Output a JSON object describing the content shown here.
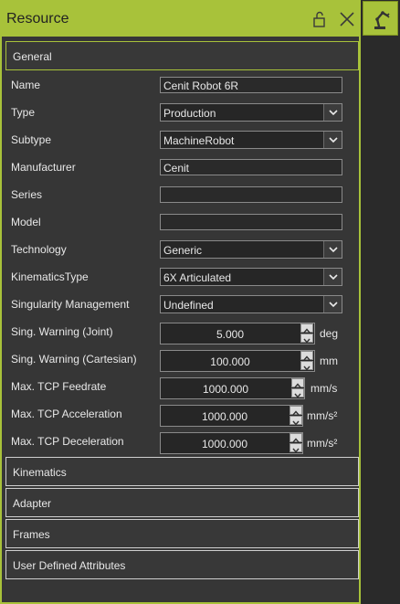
{
  "window": {
    "title": "Resource"
  },
  "icons": {
    "lock": "unlock-icon",
    "close": "close-icon",
    "side": "robot-arm-icon"
  },
  "colors": {
    "accent": "#a8c23a",
    "panel_bg": "#363636"
  },
  "sections": {
    "general": "General",
    "kinematics": "Kinematics",
    "adapter": "Adapter",
    "frames": "Frames",
    "user_defined": "User Defined Attributes"
  },
  "fields": {
    "name": {
      "label": "Name",
      "value": "Cenit Robot 6R"
    },
    "type": {
      "label": "Type",
      "value": "Production"
    },
    "subtype": {
      "label": "Subtype",
      "value": "MachineRobot"
    },
    "manufacturer": {
      "label": "Manufacturer",
      "value": "Cenit"
    },
    "series": {
      "label": "Series",
      "value": ""
    },
    "model": {
      "label": "Model",
      "value": ""
    },
    "technology": {
      "label": "Technology",
      "value": "Generic"
    },
    "kinematics_type": {
      "label": "KinematicsType",
      "value": "6X Articulated"
    },
    "singularity": {
      "label": "Singularity Management",
      "value": "Undefined"
    },
    "sing_joint": {
      "label": "Sing. Warning (Joint)",
      "value": "5.000",
      "unit": "deg"
    },
    "sing_cart": {
      "label": "Sing. Warning (Cartesian)",
      "value": "100.000",
      "unit": "mm"
    },
    "tcp_feed": {
      "label": "Max. TCP Feedrate",
      "value": "1000.000",
      "unit": "mm/s"
    },
    "tcp_acc": {
      "label": "Max. TCP Acceleration",
      "value": "1000.000",
      "unit": "mm/s²"
    },
    "tcp_dec": {
      "label": "Max. TCP Deceleration",
      "value": "1000.000",
      "unit": "mm/s²"
    }
  }
}
